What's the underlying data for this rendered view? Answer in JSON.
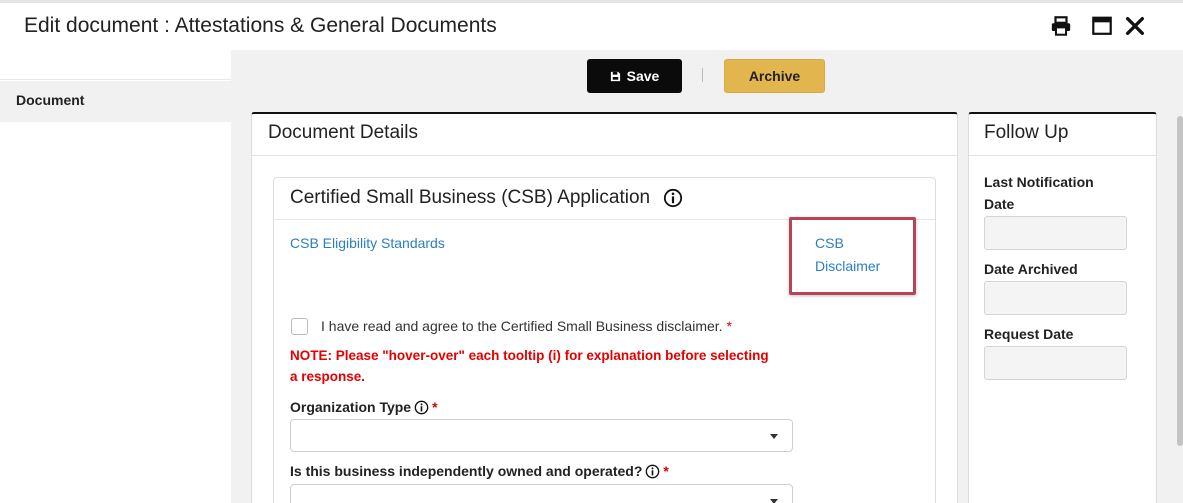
{
  "header": {
    "title": "Edit document : Attestations & General Documents"
  },
  "sidebar": {
    "items": [
      {
        "label": "Document"
      }
    ]
  },
  "toolbar": {
    "save_label": "Save",
    "archive_label": "Archive"
  },
  "document_details": {
    "title": "Document Details",
    "csb": {
      "title": "Certified Small Business (CSB) Application",
      "eligibility_link": "CSB Eligibility Standards",
      "disclaimer_link_line1": "CSB",
      "disclaimer_link_line2": "Disclaimer",
      "checkbox_label": "I have read and agree to the Certified Small Business disclaimer.",
      "required_mark": "*",
      "note_line1": "NOTE:  Please \"hover-over\" each tooltip (i) for explanation before selecting",
      "note_line2": "a response.",
      "fields": [
        {
          "label": "Organization Type",
          "value": ""
        },
        {
          "label": "Is this business independently owned and operated?",
          "value": ""
        }
      ]
    }
  },
  "follow_up": {
    "title": "Follow Up",
    "fields": [
      {
        "label_line1": "Last Notification",
        "label_line2": "Date",
        "value": ""
      },
      {
        "label": "Date Archived",
        "value": ""
      },
      {
        "label": "Request Date",
        "value": ""
      }
    ]
  },
  "colors": {
    "save_button": "#0b0b0b",
    "archive_button": "#e2b54e",
    "link": "#2a7fc1",
    "note": "#e40000",
    "highlight_box": "#b5455b"
  },
  "icons": [
    "print-icon",
    "maximize-icon",
    "close-icon",
    "save-icon",
    "info-icon",
    "chevron-down-icon"
  ]
}
